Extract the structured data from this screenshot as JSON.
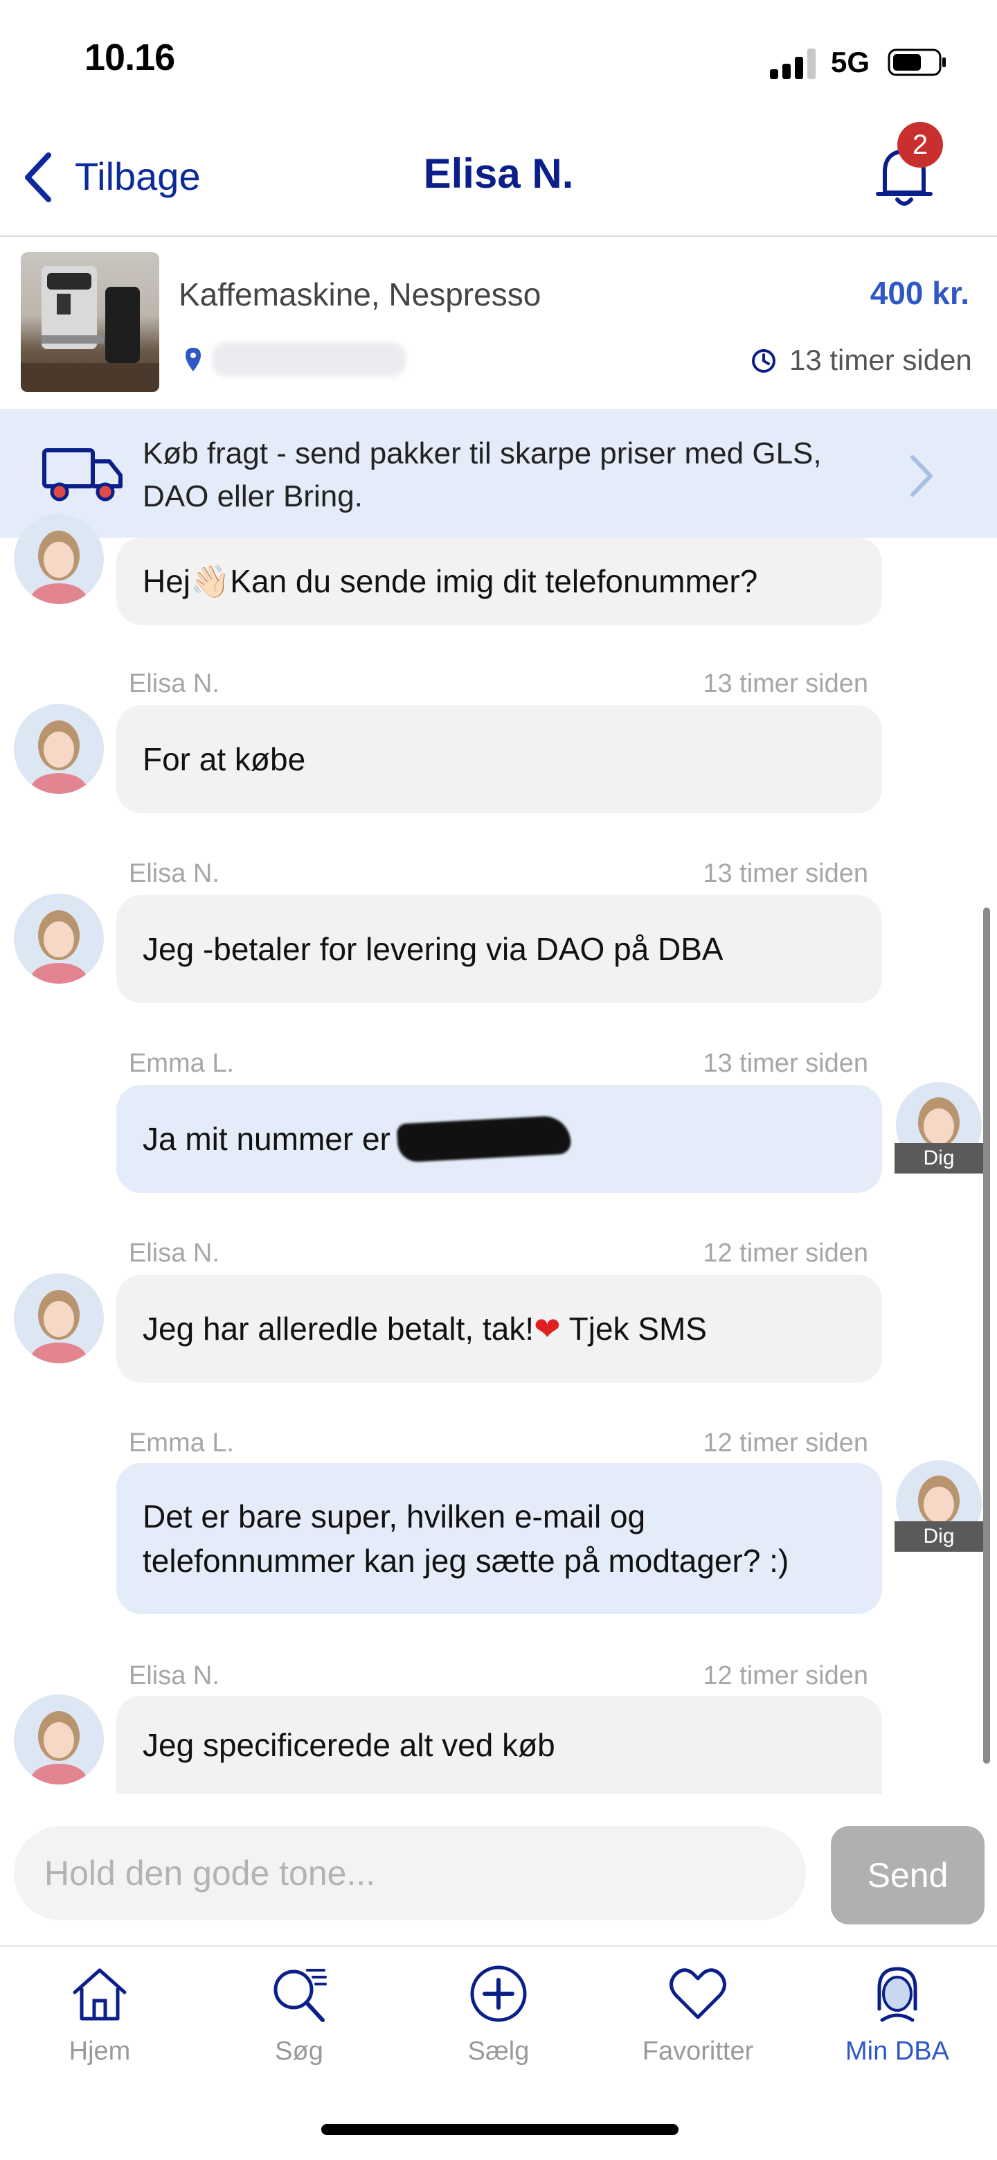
{
  "status": {
    "time": "10.16",
    "network": "5G"
  },
  "header": {
    "back_label": "Tilbage",
    "title": "Elisa N.",
    "notification_count": "2"
  },
  "listing": {
    "title": "Kaffemaskine, Nespresso",
    "price": "400 kr.",
    "posted": "13 timer siden"
  },
  "banner": {
    "text": "Køb fragt - send pakker til skarpe priser med GLS, DAO eller Bring."
  },
  "messages": [
    {
      "text": "Hej👋🏻Kan du sende imig dit telefonummer?"
    },
    {
      "sender": "Elisa N.",
      "time": "13 timer siden",
      "text": "For at købe"
    },
    {
      "sender": "Elisa N.",
      "time": "13 timer siden",
      "text": "Jeg -betaler for levering via DAO på DBA"
    },
    {
      "sender": "Emma L.",
      "time": "13 timer siden",
      "text": "Ja mit nummer er"
    },
    {
      "sender": "Elisa N.",
      "time": "12 timer siden",
      "text_before": "Jeg har alleredle betalt, tak!",
      "emoji": "❤",
      "text_after": " Tjek SMS"
    },
    {
      "sender": "Emma L.",
      "time": "12 timer siden",
      "text": "Det er bare super, hvilken e-mail og telefonnummer kan jeg sætte på modtager? :)"
    },
    {
      "sender": "Elisa N.",
      "time": "12 timer siden",
      "text": "Jeg specificerede alt ved køb"
    }
  ],
  "me_label": "Dig",
  "composer": {
    "placeholder": "Hold den gode tone...",
    "send_label": "Send"
  },
  "tabs": [
    {
      "label": "Hjem",
      "icon": "home-icon"
    },
    {
      "label": "Søg",
      "icon": "search-icon"
    },
    {
      "label": "Sælg",
      "icon": "plus-circle-icon"
    },
    {
      "label": "Favoritter",
      "icon": "heart-icon"
    },
    {
      "label": "Min DBA",
      "icon": "profile-icon",
      "active": true
    }
  ],
  "colors": {
    "brand_blue": "#0a1f8a",
    "accent_blue": "#2f58c4",
    "badge_red": "#c92f2f",
    "my_bubble": "#e3ecf8",
    "their_bubble": "#f2f2f2"
  }
}
